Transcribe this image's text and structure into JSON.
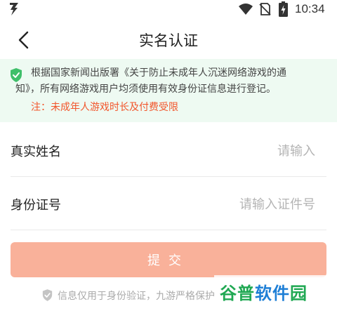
{
  "status_bar": {
    "time": "10:34",
    "icons": [
      "app-icon",
      "wifi-icon",
      "no-sim-icon",
      "battery-charging-icon"
    ]
  },
  "header": {
    "title": "实名认证",
    "back_icon": "chevron-left-icon"
  },
  "notice": {
    "icon": "shield-check-icon",
    "line1": "根据国家新闻出版署《关于防止未成年人沉迷网络游戏的通",
    "line2": "知》，所有网络游戏用户均须使用有效身份证信息进行登记。",
    "warning": "注：未成年人游戏时长及付费受限",
    "accent_color": "#f2552b",
    "background_color": "#eefaf2"
  },
  "form": {
    "name_label": "真实姓名",
    "name_value": "",
    "name_placeholder": "请输入",
    "id_label": "身份证号",
    "id_value": "",
    "id_placeholder": "请输入证件号"
  },
  "submit": {
    "label": "提交",
    "color": "#f9b19a"
  },
  "footer": {
    "text": "信息仅用于身份验证，九游严格保护",
    "icon": "shield-check-icon"
  },
  "watermark": {
    "part1": "谷普",
    "part2": "软件",
    "part3": "园"
  }
}
